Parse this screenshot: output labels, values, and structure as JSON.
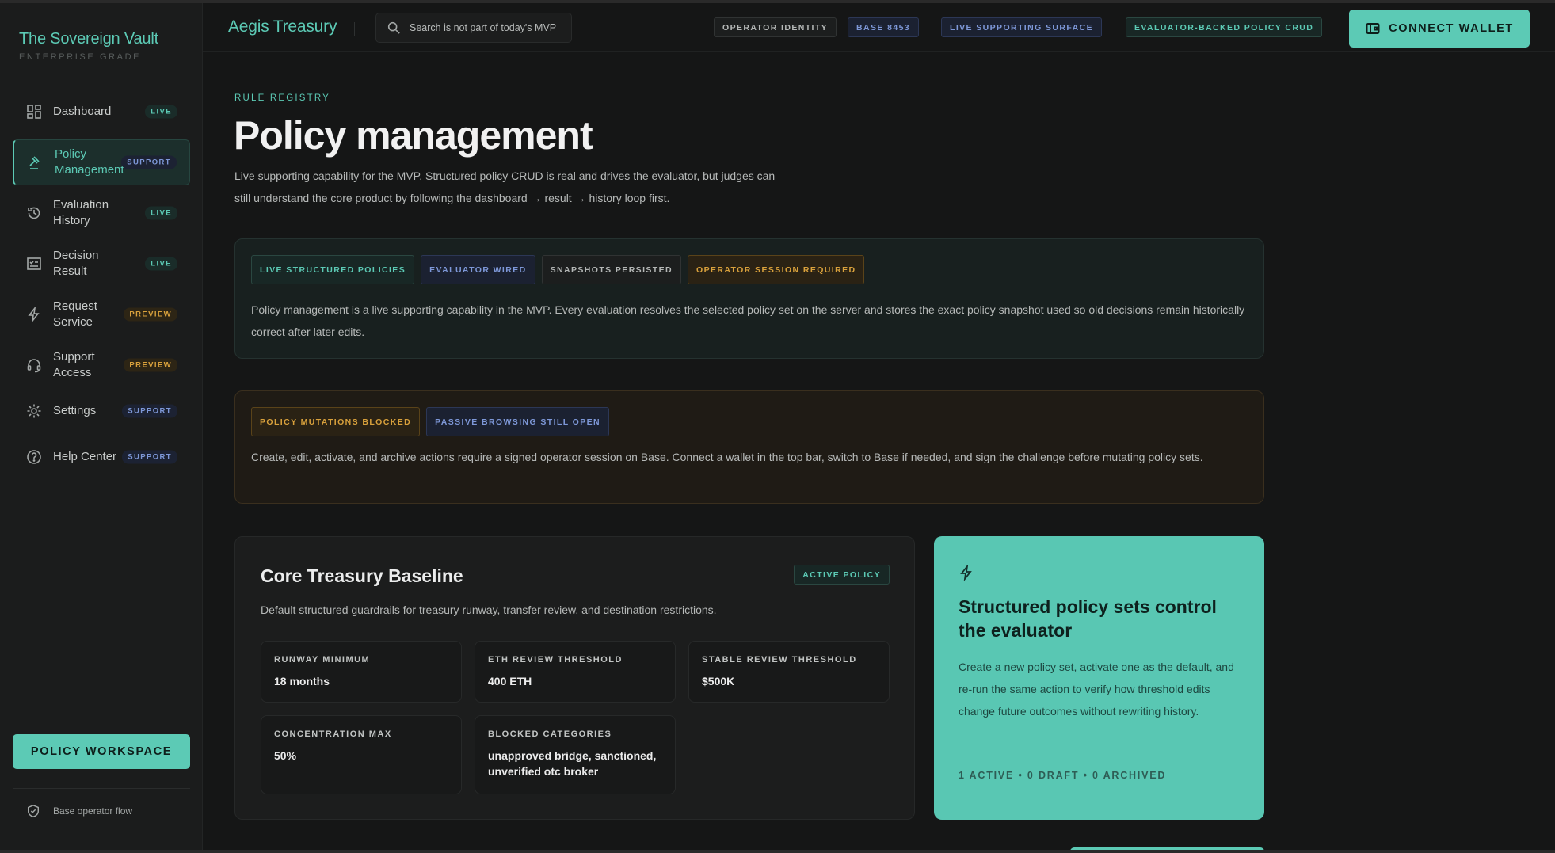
{
  "brand": {
    "title": "The Sovereign Vault",
    "subtitle": "ENTERPRISE GRADE"
  },
  "sidebar": {
    "items": [
      {
        "label": "Dashboard",
        "badge": "LIVE",
        "icon": "dashboard-grid-icon"
      },
      {
        "label": "Policy Management",
        "badge": "SUPPORT",
        "icon": "gavel-icon",
        "active": true
      },
      {
        "label": "Evaluation History",
        "badge": "LIVE",
        "icon": "history-icon"
      },
      {
        "label": "Decision Result",
        "badge": "LIVE",
        "icon": "checklist-icon"
      },
      {
        "label": "Request Service",
        "badge": "PREVIEW",
        "icon": "bolt-icon"
      },
      {
        "label": "Support Access",
        "badge": "PREVIEW",
        "icon": "headset-icon"
      },
      {
        "label": "Settings",
        "badge": "SUPPORT",
        "icon": "gear-icon"
      },
      {
        "label": "Help Center",
        "badge": "SUPPORT",
        "icon": "help-circle-icon"
      }
    ],
    "workspace_button": "POLICY WORKSPACE",
    "footer": "Base operator flow"
  },
  "topbar": {
    "app_title": "Aegis Treasury",
    "search_placeholder": "Search is not part of today's MVP",
    "chips": [
      "OPERATOR IDENTITY",
      "BASE 8453",
      "LIVE SUPPORTING SURFACE",
      "EVALUATOR-BACKED POLICY CRUD"
    ],
    "connect_button": "CONNECT WALLET"
  },
  "main": {
    "eyebrow": "RULE REGISTRY",
    "title": "Policy management",
    "description": "Live supporting capability for the MVP. Structured policy CRUD is real and drives the evaluator, but judges can still understand the core product by following the dashboard → result → history loop first.",
    "status_panel": {
      "tags": [
        "LIVE STRUCTURED POLICIES",
        "EVALUATOR WIRED",
        "SNAPSHOTS PERSISTED",
        "OPERATOR SESSION REQUIRED"
      ],
      "text": "Policy management is a live supporting capability in the MVP. Every evaluation resolves the selected policy set on the server and stores the exact policy snapshot used so old decisions remain historically correct after later edits."
    },
    "warning_panel": {
      "tags": [
        "POLICY MUTATIONS BLOCKED",
        "PASSIVE BROWSING STILL OPEN"
      ],
      "text": "Create, edit, activate, and archive actions require a signed operator session on Base. Connect a wallet in the top bar, switch to Base if needed, and sign the challenge before mutating policy sets."
    },
    "policy": {
      "name": "Core Treasury Baseline",
      "status": "ACTIVE POLICY",
      "description": "Default structured guardrails for treasury runway, transfer review, and destination restrictions.",
      "metrics": [
        {
          "label": "RUNWAY MINIMUM",
          "value": "18 months"
        },
        {
          "label": "ETH REVIEW THRESHOLD",
          "value": "400 ETH"
        },
        {
          "label": "STABLE REVIEW THRESHOLD",
          "value": "$500K"
        },
        {
          "label": "CONCENTRATION MAX",
          "value": "50%"
        },
        {
          "label": "BLOCKED CATEGORIES",
          "value": "unapproved bridge, sanctioned, unverified otc broker"
        }
      ]
    },
    "info_card": {
      "icon": "bolt-icon",
      "title": "Structured policy sets control the evaluator",
      "text": "Create a new policy set, activate one as the default, and re-run the same action to verify how threshold edits change future outcomes without rewriting history.",
      "footer": "1 ACTIVE • 0 DRAFT • 0 ARCHIVED"
    }
  },
  "colors": {
    "accent": "#5ccab5",
    "background": "#151616",
    "support_blue": "#7e98d8",
    "preview_orange": "#d9a13c"
  }
}
